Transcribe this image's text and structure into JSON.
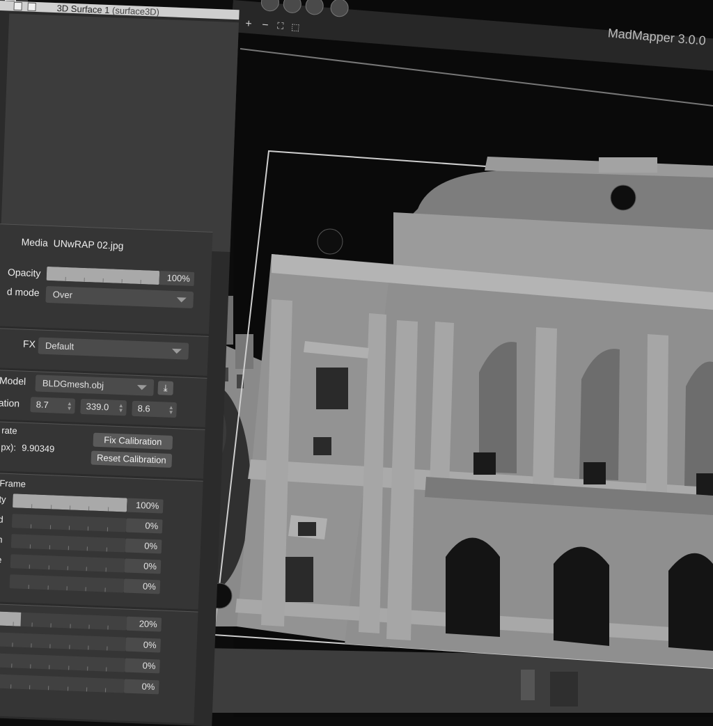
{
  "window": {
    "app_title": "MadMapper 3.0.0"
  },
  "surface": {
    "title": "3D Surface 1",
    "subtitle": "(surface3D)"
  },
  "viewport_toolbar": {
    "add": "+",
    "remove": "−",
    "fit": "⛶",
    "select": "⬚"
  },
  "media": {
    "label": "Media",
    "value": "UNwRAP 02.jpg"
  },
  "opacity": {
    "label": "Opacity",
    "value": "100%",
    "level": 1.0
  },
  "blend_mode": {
    "label": "d mode",
    "value": "Over"
  },
  "fx": {
    "label": "FX",
    "value": "Default"
  },
  "model": {
    "label": "Model",
    "value": "BLDGmesh.obj"
  },
  "location": {
    "label": "ation",
    "x": "8.7",
    "y": "339.0",
    "z": "8.6"
  },
  "calibrate": {
    "label": "rate",
    "px_label": "px):",
    "px_value": "9.90349",
    "fix_button": "Fix Calibration",
    "reset_button": "Reset Calibration"
  },
  "frame": {
    "label": "Frame",
    "rows": [
      {
        "label": "ty",
        "value": "100%",
        "level": 1.0
      },
      {
        "label": "d",
        "value": "0%",
        "level": 0.0
      },
      {
        "label": "n",
        "value": "0%",
        "level": 0.0
      },
      {
        "label": "e",
        "value": "0%",
        "level": 0.0
      },
      {
        "label": "",
        "value": "0%",
        "level": 0.0
      }
    ]
  },
  "effects": {
    "rows": [
      {
        "value": "20%",
        "level": 0.2
      },
      {
        "value": "0%",
        "level": 0.0
      },
      {
        "value": "0%",
        "level": 0.0
      },
      {
        "value": "0%",
        "level": 0.0
      }
    ]
  },
  "colors": {
    "panel": "#2b2b2b",
    "section": "#353535",
    "slider_fill": "#a9a9a9",
    "viewport": "#0a0a0a"
  }
}
